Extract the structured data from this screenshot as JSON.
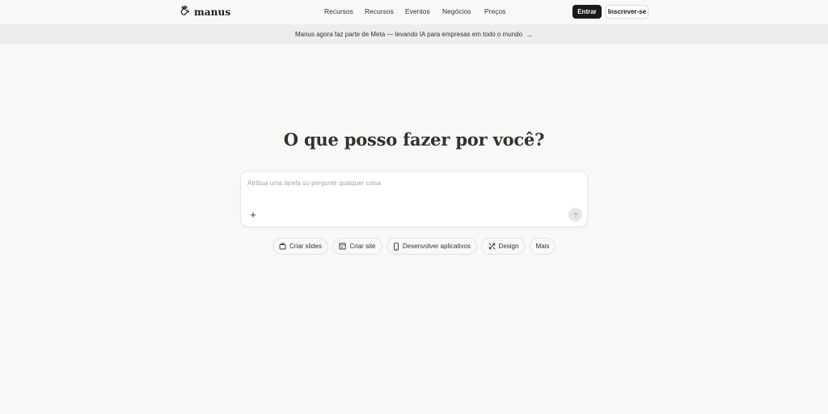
{
  "header": {
    "logo_text": "manus",
    "nav": [
      "Recursos",
      "Recursos",
      "Eventos",
      "Negócios",
      "Preços"
    ],
    "login_label": "Entrar",
    "signup_label": "Inscrever-se"
  },
  "banner": {
    "text": "Manus agora faz parte de Meta — levando IA para empresas em todo o mundo",
    "arrow": "→"
  },
  "main": {
    "headline": "O que posso fazer por você?",
    "input_placeholder": "Atribua uma tarefa ou pergunte qualquer coisa",
    "plus_glyph": "+",
    "chips": [
      "Criar slides",
      "Criar site",
      "Desenvolver aplicativos",
      "Design",
      "Mais"
    ]
  },
  "colors": {
    "background": "#f8f8f7",
    "banner": "#ededeb",
    "primary_button": "#1a1a19",
    "text": "#34322d"
  },
  "icons": {
    "logo": "manus-hand-icon",
    "send": "arrow-up-icon",
    "chip_slides": "presentation-icon",
    "chip_site": "browser-window-icon",
    "chip_apps": "mobile-phone-icon",
    "chip_design": "design-tools-icon"
  }
}
